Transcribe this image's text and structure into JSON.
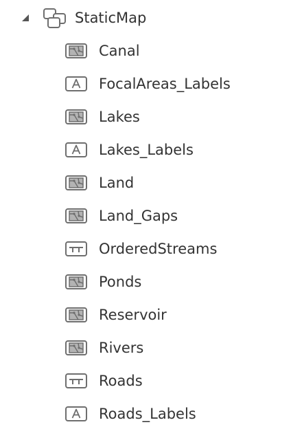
{
  "tree": {
    "root": {
      "label": "StaticMap",
      "expanded": true,
      "icon": "group-layer-icon"
    },
    "layers": [
      {
        "label": "Canal",
        "icon": "polygon-layer-icon"
      },
      {
        "label": "FocalAreas_Labels",
        "icon": "annotation-layer-icon"
      },
      {
        "label": "Lakes",
        "icon": "polygon-layer-icon"
      },
      {
        "label": "Lakes_Labels",
        "icon": "annotation-layer-icon"
      },
      {
        "label": "Land",
        "icon": "polygon-layer-icon"
      },
      {
        "label": "Land_Gaps",
        "icon": "polygon-layer-icon"
      },
      {
        "label": "OrderedStreams",
        "icon": "line-layer-icon"
      },
      {
        "label": "Ponds",
        "icon": "polygon-layer-icon"
      },
      {
        "label": "Reservoir",
        "icon": "polygon-layer-icon"
      },
      {
        "label": "Rivers",
        "icon": "polygon-layer-icon"
      },
      {
        "label": "Roads",
        "icon": "line-layer-icon"
      },
      {
        "label": "Roads_Labels",
        "icon": "annotation-layer-icon"
      }
    ]
  },
  "colors": {
    "text": "#333333",
    "icon_stroke": "#6e6e6e",
    "icon_fill": "#b3b3b3",
    "expander": "#555555"
  }
}
